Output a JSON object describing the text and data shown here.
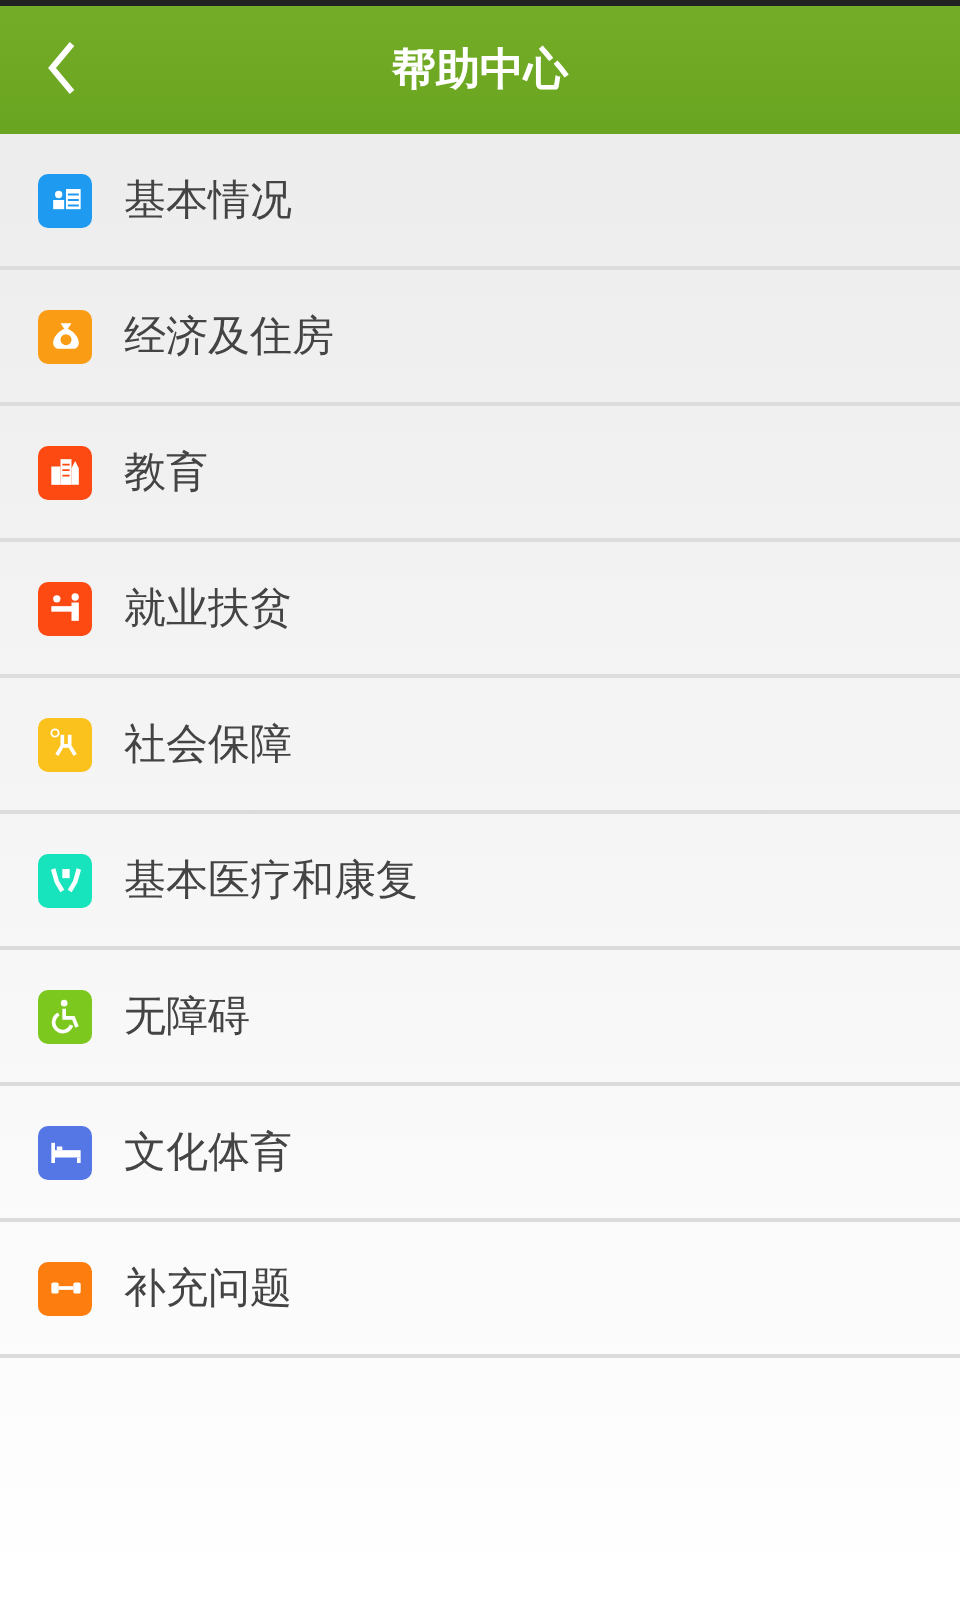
{
  "header": {
    "title": "帮助中心"
  },
  "items": [
    {
      "label": "基本情况",
      "kind": "card",
      "color": "#1e9bf0"
    },
    {
      "label": "经济及住房",
      "kind": "money",
      "color": "#fb9d14"
    },
    {
      "label": "教育",
      "kind": "buildings",
      "color": "#fd4a12"
    },
    {
      "label": "就业扶贫",
      "kind": "desk",
      "color": "#fd4a12"
    },
    {
      "label": "社会保障",
      "kind": "people",
      "color": "#fbc21d"
    },
    {
      "label": "基本医疗和康复",
      "kind": "hands",
      "color": "#17e3bd"
    },
    {
      "label": "无障碍",
      "kind": "wheelchair",
      "color": "#7dc81f"
    },
    {
      "label": "文化体育",
      "kind": "bed",
      "color": "#5577e6"
    },
    {
      "label": "补充问题",
      "kind": "dumbbell",
      "color": "#fd7e0f"
    }
  ]
}
